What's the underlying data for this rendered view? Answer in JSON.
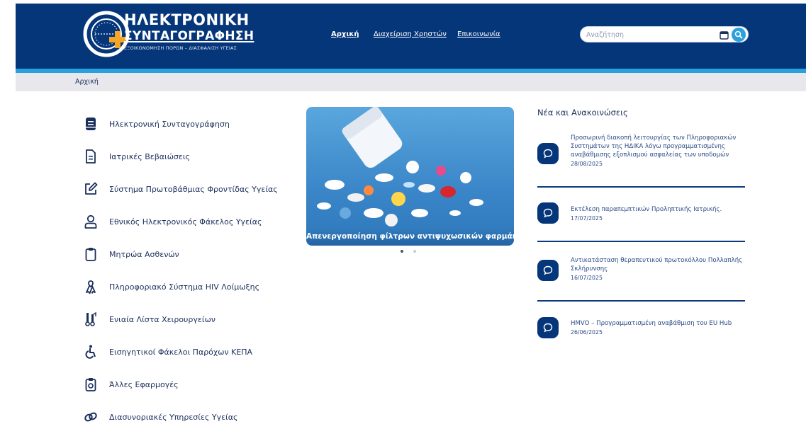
{
  "logo": {
    "line1": "ΗΛΕΚΤΡΟΝΙΚΗ",
    "line2": "ΣΥΝΤΑΓΟΓΡΑΦΗΣΗ",
    "tagline": "ΕΞΟΙΚΟΝΟΜΗΣΗ ΠΟΡΩΝ – ΔΙΑΣΦΑΛΙΣΗ ΥΓΕΙΑΣ"
  },
  "nav": {
    "home": "Αρχική",
    "users": "Διαχείριση Χρηστών",
    "contact": "Επικοινωνία"
  },
  "search": {
    "placeholder": "Αναζήτηση"
  },
  "breadcrumb": {
    "current": "Αρχική"
  },
  "menu": [
    {
      "label": "Ηλεκτρονική Συνταγογράφηση",
      "icon": "book-icon"
    },
    {
      "label": "Ιατρικές Βεβαιώσεις",
      "icon": "document-icon"
    },
    {
      "label": "Σύστημα Πρωτοβάθμιας Φροντίδας Υγείας",
      "icon": "edit-icon"
    },
    {
      "label": "Εθνικός Ηλεκτρονικός Φάκελος Υγείας",
      "icon": "user-icon"
    },
    {
      "label": "Μητρώα Ασθενών",
      "icon": "clipboard-icon"
    },
    {
      "label": "Πληροφοριακό Σύστημα HIV Λοίμωξης",
      "icon": "ribbon-icon"
    },
    {
      "label": "Ενιαία Λίστα Χειρουργείων",
      "icon": "surgery-tools-icon"
    },
    {
      "label": "Εισηγητικοί Φάκελοι Παρόχων ΚΕΠΑ",
      "icon": "wheelchair-icon"
    },
    {
      "label": "Άλλες Εφαρμογές",
      "icon": "id-badge-icon"
    },
    {
      "label": "Διασυνοριακές Υπηρεσίες Υγείας",
      "icon": "link-icon"
    }
  ],
  "carousel": {
    "caption": "Απενεργοποίηση φίλτρων αντιψυχωσικών φαρμάκων",
    "slide_count": 2,
    "active_slide": 1
  },
  "news": {
    "title": "Νέα και Ανακοινώσεις",
    "items": [
      {
        "text": "Προσωρινή διακοπή λειτουργίας των Πληροφοριακών Συστημάτων της ΗΔΙΚΑ λόγω προγραμματισμένης αναβάθμισης εξοπλισμού ασφαλείας των υποδομών",
        "date": "28/08/2025"
      },
      {
        "text": "Εκτέλεση παραπεμπτικών Προληπτικής Ιατρικής.",
        "date": "17/07/2025"
      },
      {
        "text": "Αντικατάσταση θεραπευτικού πρωτοκόλλου Πολλαπλής Σκλήρυνσης",
        "date": "16/07/2025"
      },
      {
        "text": "HMVO – Προγραμματισμένη αναβάθμιση του EU Hub",
        "date": "26/06/2025"
      }
    ]
  },
  "colors": {
    "header": "#06367a",
    "accent": "#2aa1dc",
    "logo_cross": "#f5a623",
    "text": "#1b2f5b"
  }
}
